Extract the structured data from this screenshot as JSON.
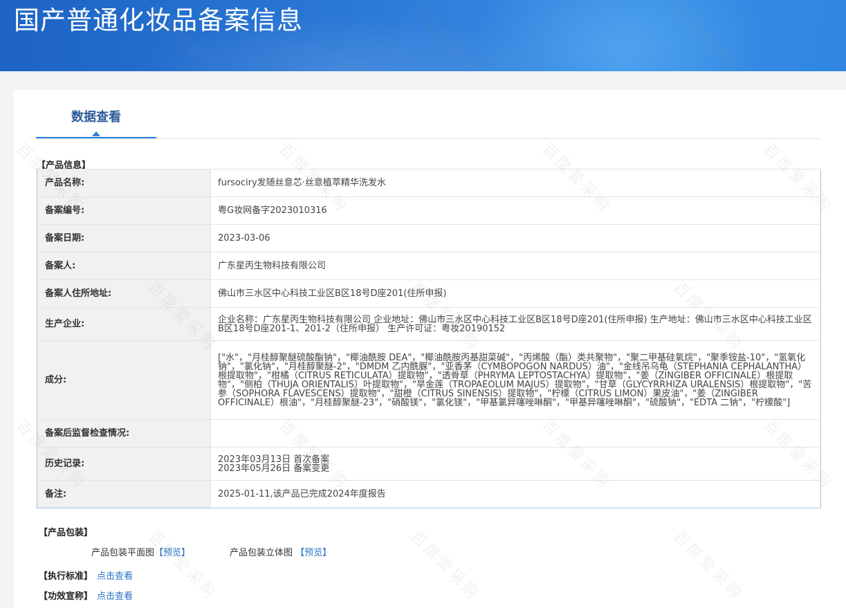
{
  "header": {
    "title": "国产普通化妆品备案信息"
  },
  "tabs": [
    {
      "label": "数据查看"
    }
  ],
  "product_info": {
    "section_label": "【产品信息】",
    "rows": [
      {
        "key": "产品名称:",
        "value": "fursociry发随丝意芯·丝意植萃精华洗发水"
      },
      {
        "key": "备案编号:",
        "value": "粤G妆网备字2023010316"
      },
      {
        "key": "备案日期:",
        "value": "2023-03-06"
      },
      {
        "key": "备案人:",
        "value": "广东星丙生物科技有限公司"
      },
      {
        "key": "备案人住所地址:",
        "value": "佛山市三水区中心科技工业区B区18号D座201(住所申报)"
      },
      {
        "key": "生产企业:",
        "value": "企业名称：广东星丙生物科技有限公司 企业地址：佛山市三水区中心科技工业区B区18号D座201(住所申报) 生产地址：佛山市三水区中心科技工业区B区18号D座201-1、201-2（住所申报） 生产许可证：粤妆20190152"
      },
      {
        "key": "成分:",
        "value": "[\"水\"，\"月桂醇聚醚硫酸酯钠\"，\"椰油酰胺 DEA\"，\"椰油酰胺丙基甜菜碱\"，\"丙烯酸（酯）类共聚物\"，\"聚二甲基硅氧烷\"，\"聚季铵盐-10\"，\"氢氧化钠\"，\"氯化钠\"，\"月桂醇聚醚-2\"，\"DMDM 乙内酰脲\"，\"亚香茅（CYMBOPOGON NARDUS）油\"，\"金线吊乌龟（STEPHANIA CEPHALANTHA）根提取物\"，\"柑橘（CITRUS RETICULATA）提取物\"，\"透骨草（PHRYMA LEPTOSTACHYA）提取物\"，\"姜（ZINGIBER OFFICINALE）根提取物\"，\"侧柏（THUJA ORIENTALIS）叶提取物\"，\"旱金莲（TROPAEOLUM MAJUS）提取物\"，\"甘草（GLYCYRRHIZA URALENSIS）根提取物\"，\"苦参（SOPHORA FLAVESCENS）提取物\"，\"甜橙（CITRUS SINENSIS）提取物\"，\"柠檬（CITRUS LIMON）果皮油\"，\"姜（ZINGIBER OFFICINALE）根油\"，\"月桂醇聚醚-23\"，\"硝酸镁\"，\"氯化镁\"，\"甲基氯异噻唑啉酮\"，\"甲基异噻唑啉酮\"，\"硫酸钠\"，\"EDTA 二钠\"，\"柠檬酸\"]"
      },
      {
        "key": "备案后监督检查情况:",
        "value": ""
      },
      {
        "key": "历史记录:",
        "value": "2023年03月13日 首次备案",
        "value2": "2023年05月26日 备案变更"
      },
      {
        "key": "备注:",
        "value": "2025-01-11,该产品已完成2024年度报告"
      }
    ]
  },
  "packaging": {
    "section_label": "【产品包装】",
    "flat_label": "产品包装平面图",
    "flat_link": "【预览】",
    "solid_label": "产品包装立体图",
    "solid_link": "【预览】"
  },
  "standard": {
    "label": "【执行标准】",
    "link": "点击查看"
  },
  "efficacy": {
    "label": "【功效宣称】",
    "link": "点击查看"
  },
  "watermark": {
    "text": "百度爱采购"
  }
}
